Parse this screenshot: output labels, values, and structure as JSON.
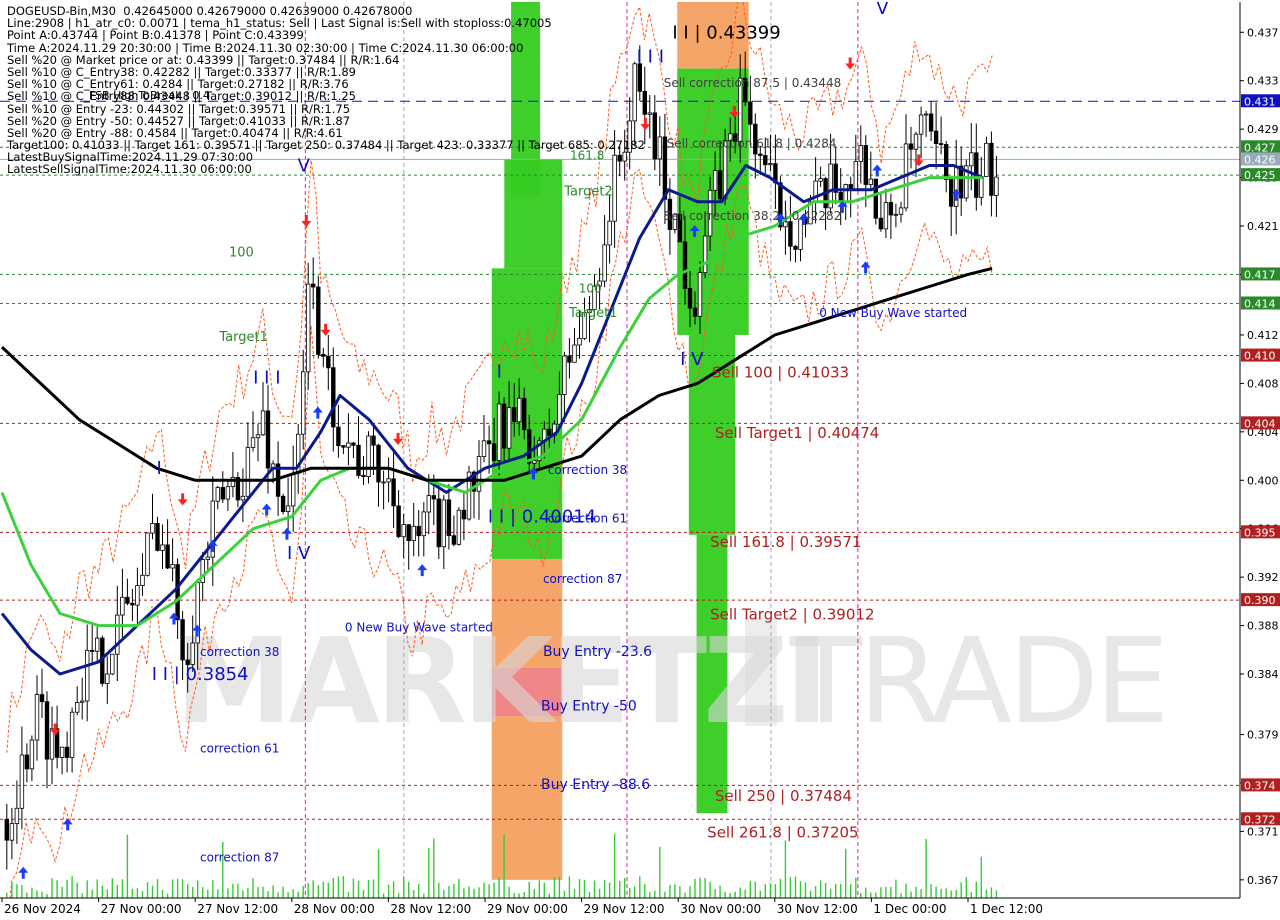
{
  "colors": {
    "candle": "#000000",
    "ma_blue": "#0b1a8c",
    "ma_green": "#3bd13b",
    "ma_black": "#000000",
    "envelope": "#ff5a1f",
    "green_zone": "#35cc1f",
    "orange_zone": "#ff8c3a",
    "pink_zone": "#f08080",
    "level_green": "#2a8a2a",
    "level_red": "#b02020",
    "level_blue": "#1010c0",
    "arrow_up": "#1a3cff",
    "arrow_down": "#ff2020"
  },
  "header_lines": [
    "DOGEUSD-Bin,M30  0.42645000 0.42679000 0.42639000 0.42678000",
    "Line:2908 | h1_atr_c0: 0.0071 | tema_h1_status: Sell | Last Signal is:Sell with stoploss:0.47005",
    "Point A:0.43744 | Point B:0.41378 | Point C:0.43399",
    "Time A:2024.11.29 20:30:00 | Time B:2024.11.30 02:30:00 | Time C:2024.11.30 06:00:00",
    "Sell %20 @ Market price or at: 0.43399 || Target:0.37484 || R/R:1.64",
    "Sell %10 @ C_Entry38: 0.42282 || Target:0.33377 || R/R:1.89",
    "Sell %10 @ C_Entry61: 0.4284 || Target:0.27182 || R/R:3.76",
    "Sell %10 @ C_Entry88: 0.43448 || Target:0.39012 || R/R:1.25",
    "Sell %10 @ Entry -23: 0.44302 || Target:0.39571 || R/R:1.75",
    "Sell %20 @ Entry -50: 0.44527 || Target:0.41033 || R/R:1.87",
    "Sell %20 @ Entry -88: 0.4584 || Target:0.40474 || R/R:4.61",
    "Target100: 0.41033 || Target 161: 0.39571 || Target 250: 0.37484 || Target 423: 0.33377 || Target 685: 0.27182",
    "LatestBuySignalTime:2024.11.29 07:30:00",
    "LatestSellSignalTime:2024.11.30 06:00:00"
  ],
  "watermark": {
    "left": "MARKETZI",
    "right": "TRADE"
  },
  "chart_data": {
    "type": "candlestick",
    "symbol": "DOGEUSD-Bin",
    "timeframe": "M30",
    "ylim": [
      0.3655,
      0.4395
    ],
    "y_ticks": [
      0.437,
      0.433,
      0.429,
      0.425,
      0.421,
      0.417,
      0.412,
      0.408,
      0.404,
      0.4,
      0.396,
      0.392,
      0.388,
      0.384,
      0.379,
      0.375,
      0.371,
      0.367
    ],
    "x_ticks": [
      "26 Nov 2024",
      "27 Nov 00:00",
      "27 Nov 12:00",
      "28 Nov 00:00",
      "28 Nov 12:00",
      "29 Nov 00:00",
      "29 Nov 12:00",
      "30 Nov 00:00",
      "30 Nov 12:00",
      "1 Dec 00:00",
      "1 Dec 12:00"
    ],
    "x_range": [
      0,
      11
    ],
    "price_path": [
      [
        0.05,
        0.372
      ],
      [
        0.2,
        0.376
      ],
      [
        0.35,
        0.381
      ],
      [
        0.5,
        0.379
      ],
      [
        0.6,
        0.377
      ],
      [
        0.8,
        0.384
      ],
      [
        1.0,
        0.385
      ],
      [
        1.2,
        0.388
      ],
      [
        1.45,
        0.392
      ],
      [
        1.6,
        0.397
      ],
      [
        1.75,
        0.392
      ],
      [
        1.9,
        0.386
      ],
      [
        2.05,
        0.392
      ],
      [
        2.25,
        0.398
      ],
      [
        2.5,
        0.401
      ],
      [
        2.7,
        0.405
      ],
      [
        2.85,
        0.399
      ],
      [
        3.0,
        0.398
      ],
      [
        3.1,
        0.405
      ],
      [
        3.2,
        0.42
      ],
      [
        3.3,
        0.409
      ],
      [
        3.45,
        0.406
      ],
      [
        3.65,
        0.402
      ],
      [
        3.9,
        0.401
      ],
      [
        4.1,
        0.398
      ],
      [
        4.25,
        0.394
      ],
      [
        4.45,
        0.397
      ],
      [
        4.6,
        0.396
      ],
      [
        4.75,
        0.398
      ],
      [
        5.0,
        0.401
      ],
      [
        5.2,
        0.405
      ],
      [
        5.45,
        0.404
      ],
      [
        5.55,
        0.401
      ],
      [
        5.7,
        0.405
      ],
      [
        5.9,
        0.411
      ],
      [
        6.05,
        0.413
      ],
      [
        6.2,
        0.419
      ],
      [
        6.4,
        0.427
      ],
      [
        6.55,
        0.432
      ],
      [
        6.7,
        0.43
      ],
      [
        6.85,
        0.425
      ],
      [
        7.0,
        0.42
      ],
      [
        7.15,
        0.415
      ],
      [
        7.3,
        0.421
      ],
      [
        7.5,
        0.427
      ],
      [
        7.65,
        0.432
      ],
      [
        7.8,
        0.428
      ],
      [
        8.0,
        0.423
      ],
      [
        8.25,
        0.421
      ],
      [
        8.5,
        0.423
      ],
      [
        8.75,
        0.425
      ],
      [
        8.95,
        0.427
      ],
      [
        9.1,
        0.42
      ],
      [
        9.3,
        0.424
      ],
      [
        9.5,
        0.429
      ],
      [
        9.7,
        0.426
      ],
      [
        9.9,
        0.424
      ],
      [
        10.1,
        0.425
      ],
      [
        10.3,
        0.426
      ]
    ],
    "moving_averages": [
      {
        "name": "",
        "color": "#0b1a8c",
        "points": [
          [
            0.0,
            0.389
          ],
          [
            0.3,
            0.386
          ],
          [
            0.6,
            0.384
          ],
          [
            1.0,
            0.385
          ],
          [
            1.4,
            0.388
          ],
          [
            1.8,
            0.391
          ],
          [
            2.2,
            0.395
          ],
          [
            2.5,
            0.398
          ],
          [
            2.8,
            0.401
          ],
          [
            3.05,
            0.401
          ],
          [
            3.3,
            0.404
          ],
          [
            3.5,
            0.407
          ],
          [
            3.8,
            0.405
          ],
          [
            4.2,
            0.401
          ],
          [
            4.6,
            0.399
          ],
          [
            5.0,
            0.401
          ],
          [
            5.4,
            0.402
          ],
          [
            5.75,
            0.404
          ],
          [
            6.0,
            0.408
          ],
          [
            6.3,
            0.414
          ],
          [
            6.6,
            0.42
          ],
          [
            6.9,
            0.424
          ],
          [
            7.2,
            0.423
          ],
          [
            7.45,
            0.423
          ],
          [
            7.7,
            0.426
          ],
          [
            7.95,
            0.425
          ],
          [
            8.3,
            0.423
          ],
          [
            8.6,
            0.424
          ],
          [
            9.0,
            0.424
          ],
          [
            9.3,
            0.425
          ],
          [
            9.6,
            0.426
          ],
          [
            9.85,
            0.426
          ],
          [
            10.15,
            0.425
          ]
        ]
      },
      {
        "name": "",
        "color": "#3bd13b",
        "points": [
          [
            0.0,
            0.399
          ],
          [
            0.3,
            0.393
          ],
          [
            0.6,
            0.389
          ],
          [
            1.0,
            0.388
          ],
          [
            1.4,
            0.388
          ],
          [
            1.8,
            0.39
          ],
          [
            2.2,
            0.393
          ],
          [
            2.6,
            0.396
          ],
          [
            3.0,
            0.397
          ],
          [
            3.3,
            0.4
          ],
          [
            3.6,
            0.401
          ],
          [
            4.0,
            0.401
          ],
          [
            4.4,
            0.4
          ],
          [
            4.8,
            0.399
          ],
          [
            5.2,
            0.401
          ],
          [
            5.6,
            0.402
          ],
          [
            6.0,
            0.405
          ],
          [
            6.4,
            0.411
          ],
          [
            6.7,
            0.415
          ],
          [
            7.0,
            0.417
          ],
          [
            7.3,
            0.418
          ],
          [
            7.6,
            0.42
          ],
          [
            8.0,
            0.421
          ],
          [
            8.4,
            0.423
          ],
          [
            8.8,
            0.423
          ],
          [
            9.2,
            0.424
          ],
          [
            9.6,
            0.425
          ],
          [
            10.15,
            0.425
          ]
        ]
      },
      {
        "name": "",
        "color": "#000000",
        "points": [
          [
            0.0,
            0.411
          ],
          [
            0.4,
            0.408
          ],
          [
            0.8,
            0.405
          ],
          [
            1.2,
            0.403
          ],
          [
            1.6,
            0.401
          ],
          [
            2.0,
            0.4
          ],
          [
            2.4,
            0.4
          ],
          [
            2.8,
            0.4
          ],
          [
            3.2,
            0.401
          ],
          [
            3.6,
            0.401
          ],
          [
            4.0,
            0.401
          ],
          [
            4.4,
            0.4
          ],
          [
            4.8,
            0.4
          ],
          [
            5.2,
            0.4
          ],
          [
            5.6,
            0.401
          ],
          [
            6.0,
            0.402
          ],
          [
            6.4,
            0.405
          ],
          [
            6.8,
            0.407
          ],
          [
            7.2,
            0.408
          ],
          [
            7.6,
            0.41
          ],
          [
            8.0,
            0.412
          ],
          [
            8.4,
            0.413
          ],
          [
            8.8,
            0.414
          ],
          [
            9.2,
            0.415
          ],
          [
            9.6,
            0.416
          ],
          [
            10.0,
            0.417
          ],
          [
            10.25,
            0.4175
          ]
        ]
      }
    ],
    "levels": [
      {
        "price": 0.4313,
        "style": "dash",
        "color": "#1010c0",
        "tag": "0.431"
      },
      {
        "price": 0.4275,
        "style": "dot",
        "color": "#2a8a2a",
        "tag": "0.427"
      },
      {
        "price": 0.4265,
        "style": "solid",
        "color": "#99aabb",
        "tag": "0.426"
      },
      {
        "price": 0.4252,
        "style": "dot",
        "color": "#2a8a2a",
        "tag": "0.425"
      },
      {
        "price": 0.417,
        "style": "dot",
        "color": "#2a8a2a",
        "tag": "0.417"
      },
      {
        "price": 0.4146,
        "style": "dot",
        "color": "#2a8a2a",
        "tag": "0.414"
      },
      {
        "price": 0.4103,
        "style": "dot",
        "color": "#b02020",
        "tag": "0.410"
      },
      {
        "price": 0.4047,
        "style": "dot",
        "color": "#b02020",
        "tag": "0.404"
      },
      {
        "price": 0.3957,
        "style": "dot",
        "color": "#b02020",
        "tag": "0.395"
      },
      {
        "price": 0.3901,
        "style": "dot",
        "color": "#b02020",
        "tag": "0.390"
      },
      {
        "price": 0.3748,
        "style": "dot",
        "color": "#b02020",
        "tag": "0.374"
      },
      {
        "price": 0.372,
        "style": "dot",
        "color": "#b02020",
        "tag": "0.372"
      }
    ],
    "zones": [
      {
        "x0": 5.27,
        "x1": 5.57,
        "y0": 0.4395,
        "y1": 0.4235,
        "color": "#35cc1f"
      },
      {
        "x0": 5.2,
        "x1": 5.8,
        "y0": 0.4265,
        "y1": 0.4175,
        "color": "#35cc1f"
      },
      {
        "x0": 5.07,
        "x1": 5.8,
        "y0": 0.4175,
        "y1": 0.3935,
        "color": "#35cc1f"
      },
      {
        "x0": 5.07,
        "x1": 5.8,
        "y0": 0.3935,
        "y1": 0.3845,
        "color": "#f5a060"
      },
      {
        "x0": 5.07,
        "x1": 5.8,
        "y0": 0.3845,
        "y1": 0.3805,
        "color": "#f08080"
      },
      {
        "x0": 5.07,
        "x1": 5.8,
        "y0": 0.3805,
        "y1": 0.367,
        "color": "#f5a060"
      },
      {
        "x0": 6.99,
        "x1": 7.73,
        "y0": 0.4395,
        "y1": 0.434,
        "color": "#f5a060"
      },
      {
        "x0": 6.99,
        "x1": 7.73,
        "y0": 0.434,
        "y1": 0.412,
        "color": "#35cc1f"
      },
      {
        "x0": 7.11,
        "x1": 7.59,
        "y0": 0.412,
        "y1": 0.3955,
        "color": "#35cc1f"
      },
      {
        "x0": 7.19,
        "x1": 7.51,
        "y0": 0.3955,
        "y1": 0.3725,
        "color": "#35cc1f"
      }
    ],
    "vlines": [
      {
        "x": 3.14,
        "color": "#dd2299"
      },
      {
        "x": 6.47,
        "color": "#dd2299"
      },
      {
        "x": 8.86,
        "color": "#dd2299"
      },
      {
        "x": 4.16,
        "color": "#9aa8c8"
      },
      {
        "x": 7.96,
        "color": "#9aa8c8"
      }
    ],
    "up_arrows": [
      [
        0.22,
        0.3675
      ],
      [
        0.68,
        0.3715
      ],
      [
        1.78,
        0.3885
      ],
      [
        2.02,
        0.3875
      ],
      [
        2.18,
        0.3945
      ],
      [
        2.74,
        0.3975
      ],
      [
        2.95,
        0.3955
      ],
      [
        3.27,
        0.4055
      ],
      [
        4.35,
        0.3925
      ],
      [
        5.5,
        0.4005
      ],
      [
        7.17,
        0.4205
      ],
      [
        8.06,
        0.4215
      ],
      [
        8.3,
        0.4215
      ],
      [
        8.7,
        0.4225
      ],
      [
        8.94,
        0.4175
      ],
      [
        9.06,
        0.4255
      ],
      [
        9.88,
        0.4235
      ]
    ],
    "down_arrows": [
      [
        0.55,
        0.3795
      ],
      [
        1.87,
        0.3985
      ],
      [
        3.15,
        0.4215
      ],
      [
        3.35,
        0.4125
      ],
      [
        4.1,
        0.4035
      ],
      [
        6.66,
        0.4295
      ],
      [
        7.58,
        0.4305
      ],
      [
        8.78,
        0.4345
      ],
      [
        9.49,
        0.4265
      ]
    ],
    "annotations": [
      {
        "text": "V",
        "x": 3.06,
        "y": 0.4255,
        "color": "#1010c0",
        "size": 18
      },
      {
        "text": "I I I",
        "x": 2.6,
        "y": 0.408,
        "color": "#1010c0",
        "size": 18
      },
      {
        "text": "I",
        "x": 1.6,
        "y": 0.4005,
        "color": "#1010c0",
        "size": 18
      },
      {
        "text": "I V",
        "x": 2.95,
        "y": 0.3935,
        "color": "#1010c0",
        "size": 18
      },
      {
        "text": "I I | 0.3854",
        "x": 1.55,
        "y": 0.3835,
        "color": "#1010c0",
        "size": 18
      },
      {
        "text": "I",
        "x": 5.12,
        "y": 0.4085,
        "color": "#1010c0",
        "size": 18
      },
      {
        "text": "I I | 0.40014",
        "x": 5.03,
        "y": 0.3965,
        "color": "#1010c0",
        "size": 18
      },
      {
        "text": "I I I",
        "x": 6.57,
        "y": 0.4345,
        "color": "#1010c0",
        "size": 18
      },
      {
        "text": "I I | 0.43399",
        "x": 6.94,
        "y": 0.4365,
        "color": "#000000",
        "size": 18
      },
      {
        "text": "I V",
        "x": 7.02,
        "y": 0.4095,
        "color": "#1010c0",
        "size": 18
      },
      {
        "text": "V",
        "x": 9.05,
        "y": 0.4385,
        "color": "#1010c0",
        "size": 18
      },
      {
        "text": "100",
        "x": 2.35,
        "y": 0.4185,
        "color": "#2a8a2a",
        "size": 13
      },
      {
        "text": "Target1",
        "x": 2.25,
        "y": 0.4115,
        "color": "#2a8a2a",
        "size": 13
      },
      {
        "text": "161.8",
        "x": 5.88,
        "y": 0.4265,
        "color": "#2a8a2a",
        "size": 12
      },
      {
        "text": "Target2",
        "x": 5.82,
        "y": 0.4235,
        "color": "#2a8a2a",
        "size": 13
      },
      {
        "text": "100",
        "x": 5.97,
        "y": 0.4155,
        "color": "#2a8a2a",
        "size": 12
      },
      {
        "text": "Target1",
        "x": 5.87,
        "y": 0.4135,
        "color": "#2a8a2a",
        "size": 13
      },
      {
        "text": "correction 38",
        "x": 2.05,
        "y": 0.3855,
        "color": "#1010c0",
        "size": 12
      },
      {
        "text": "correction 61",
        "x": 2.05,
        "y": 0.3775,
        "color": "#1010c0",
        "size": 12
      },
      {
        "text": "correction 87",
        "x": 2.05,
        "y": 0.3685,
        "color": "#1010c0",
        "size": 12
      },
      {
        "text": "0 New Buy Wave started",
        "x": 3.55,
        "y": 0.3875,
        "color": "#1010c0",
        "size": 12
      },
      {
        "text": "correction 38",
        "x": 5.65,
        "y": 0.4005,
        "color": "#1010c0",
        "size": 12
      },
      {
        "text": "correction 61",
        "x": 5.65,
        "y": 0.3965,
        "color": "#1010c0",
        "size": 12
      },
      {
        "text": "correction 87",
        "x": 5.6,
        "y": 0.3915,
        "color": "#1010c0",
        "size": 12
      },
      {
        "text": "Buy Entry -23.6",
        "x": 5.6,
        "y": 0.3855,
        "color": "#1010c0",
        "size": 14
      },
      {
        "text": "Buy Entry -50",
        "x": 5.58,
        "y": 0.381,
        "color": "#1010c0",
        "size": 14
      },
      {
        "text": "Buy Entry -88.6",
        "x": 5.58,
        "y": 0.3745,
        "color": "#1010c0",
        "size": 14
      },
      {
        "text": "Sell correction 87.5 | 0.43448",
        "x": 6.85,
        "y": 0.4325,
        "color": "#404040",
        "size": 12
      },
      {
        "text": "Sell correction 61.8 | 0.4284",
        "x": 6.88,
        "y": 0.4275,
        "color": "#404040",
        "size": 12
      },
      {
        "text": "Sell correction 38.2 | 0.42282",
        "x": 6.85,
        "y": 0.4215,
        "color": "#404040",
        "size": 12
      },
      {
        "text": "0 New Buy Wave started",
        "x": 8.46,
        "y": 0.4135,
        "color": "#1010c0",
        "size": 12
      },
      {
        "text": "Sell 100 | 0.41033",
        "x": 7.35,
        "y": 0.4085,
        "color": "#b02020",
        "size": 15
      },
      {
        "text": "Sell Target1 | 0.40474",
        "x": 7.38,
        "y": 0.4035,
        "color": "#b02020",
        "size": 15
      },
      {
        "text": "Sell 161.8 | 0.39571",
        "x": 7.33,
        "y": 0.3945,
        "color": "#b02020",
        "size": 15
      },
      {
        "text": "Sell Target2 | 0.39012",
        "x": 7.33,
        "y": 0.3885,
        "color": "#b02020",
        "size": 15
      },
      {
        "text": "Sell  250 | 0.37484",
        "x": 7.38,
        "y": 0.3735,
        "color": "#b02020",
        "size": 15
      },
      {
        "text": "Sell  261.8 | 0.37205",
        "x": 7.3,
        "y": 0.3705,
        "color": "#b02020",
        "size": 15
      },
      {
        "text": "FSB HighToBreak | 0.4",
        "x": 0.9,
        "y": 0.4315,
        "color": "#000000",
        "size": 11
      }
    ],
    "grid": false
  }
}
